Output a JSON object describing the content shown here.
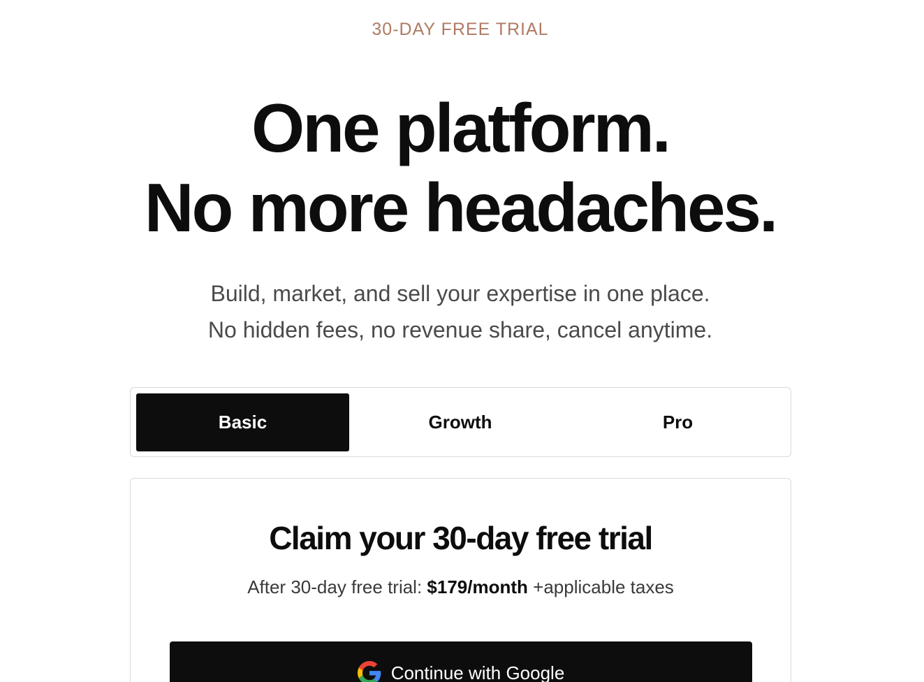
{
  "eyebrow": "30-DAY FREE TRIAL",
  "headline": {
    "line1": "One platform.",
    "line2": "No more headaches."
  },
  "subtitle": {
    "line1": "Build, market, and sell your expertise in one place.",
    "line2": "No hidden fees, no revenue share, cancel anytime."
  },
  "plans": {
    "tabs": [
      {
        "label": "Basic",
        "selected": true
      },
      {
        "label": "Growth",
        "selected": false
      },
      {
        "label": "Pro",
        "selected": false
      }
    ]
  },
  "trial_card": {
    "title": "Claim your 30-day free trial",
    "price_prefix": "After 30-day free trial:",
    "price": "$179/month",
    "price_suffix": "+applicable taxes",
    "google_button_label": "Continue with Google",
    "google_icon": "google-g-icon"
  },
  "colors": {
    "eyebrow": "#b07a63",
    "primary": "#0d0d0d",
    "border": "#d9d9d9",
    "muted_text": "#4a4a4a"
  }
}
